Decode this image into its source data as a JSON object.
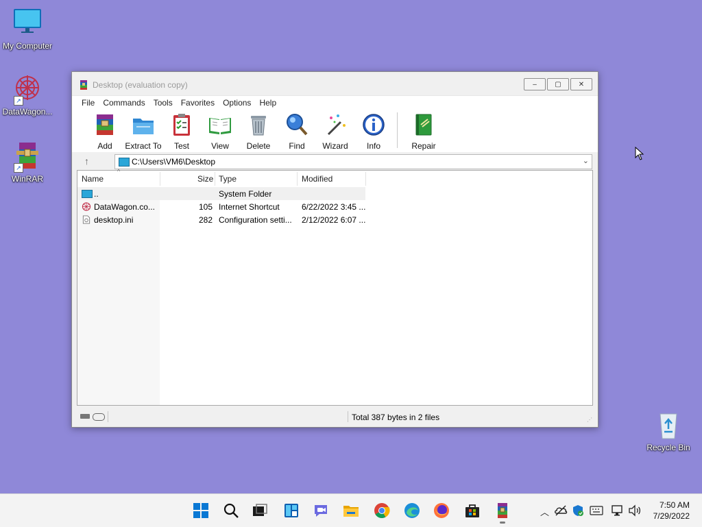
{
  "desktop": {
    "icons": [
      {
        "label": "My Computer",
        "icon": "monitor-icon"
      },
      {
        "label": "DataWagon...",
        "icon": "datawagon-icon"
      },
      {
        "label": "WinRAR",
        "icon": "winrar-icon"
      },
      {
        "label": "Recycle Bin",
        "icon": "recycle-bin-icon"
      }
    ]
  },
  "window": {
    "title": "Desktop (evaluation copy)",
    "controls": {
      "minimize": "‒",
      "maximize": "▢",
      "close": "✕"
    },
    "menu": [
      "File",
      "Commands",
      "Tools",
      "Favorites",
      "Options",
      "Help"
    ],
    "toolbar": [
      {
        "label": "Add",
        "icon": "archive-add-icon"
      },
      {
        "label": "Extract To",
        "icon": "folder-extract-icon"
      },
      {
        "label": "Test",
        "icon": "clipboard-test-icon"
      },
      {
        "label": "View",
        "icon": "book-view-icon"
      },
      {
        "label": "Delete",
        "icon": "trash-icon"
      },
      {
        "label": "Find",
        "icon": "magnifier-icon"
      },
      {
        "label": "Wizard",
        "icon": "magic-wand-icon"
      },
      {
        "label": "Info",
        "icon": "info-icon"
      },
      {
        "label": "Repair",
        "icon": "first-aid-book-icon"
      }
    ],
    "address": {
      "up": "↑",
      "path": "C:\\Users\\VM6\\Desktop",
      "dropdown": "⌄"
    },
    "columns": {
      "name": "Name",
      "size": "Size",
      "type": "Type",
      "modified": "Modified",
      "sort": "^"
    },
    "files": [
      {
        "name": "..",
        "size": "",
        "type": "System Folder",
        "modified": "",
        "icon": "folder-up-icon"
      },
      {
        "name": "DataWagon.co...",
        "size": "105",
        "type": "Internet Shortcut",
        "modified": "6/22/2022 3:45 ...",
        "icon": "shortcut-icon"
      },
      {
        "name": "desktop.ini",
        "size": "282",
        "type": "Configuration setti...",
        "modified": "2/12/2022 6:07 ...",
        "icon": "config-file-icon"
      }
    ],
    "status": "Total 387 bytes in 2 files"
  },
  "taskbar": {
    "time": "7:50 AM",
    "date": "7/29/2022",
    "apps": [
      "windows-start-icon",
      "search-icon",
      "task-view-icon",
      "widgets-icon",
      "chat-icon",
      "file-explorer-icon",
      "chrome-icon",
      "edge-icon",
      "firefox-icon",
      "store-icon",
      "winrar-icon"
    ],
    "tray": [
      "chevron-up-icon",
      "onedrive-icon",
      "security-icon",
      "keyboard-icon",
      "network-icon",
      "volume-icon"
    ]
  }
}
